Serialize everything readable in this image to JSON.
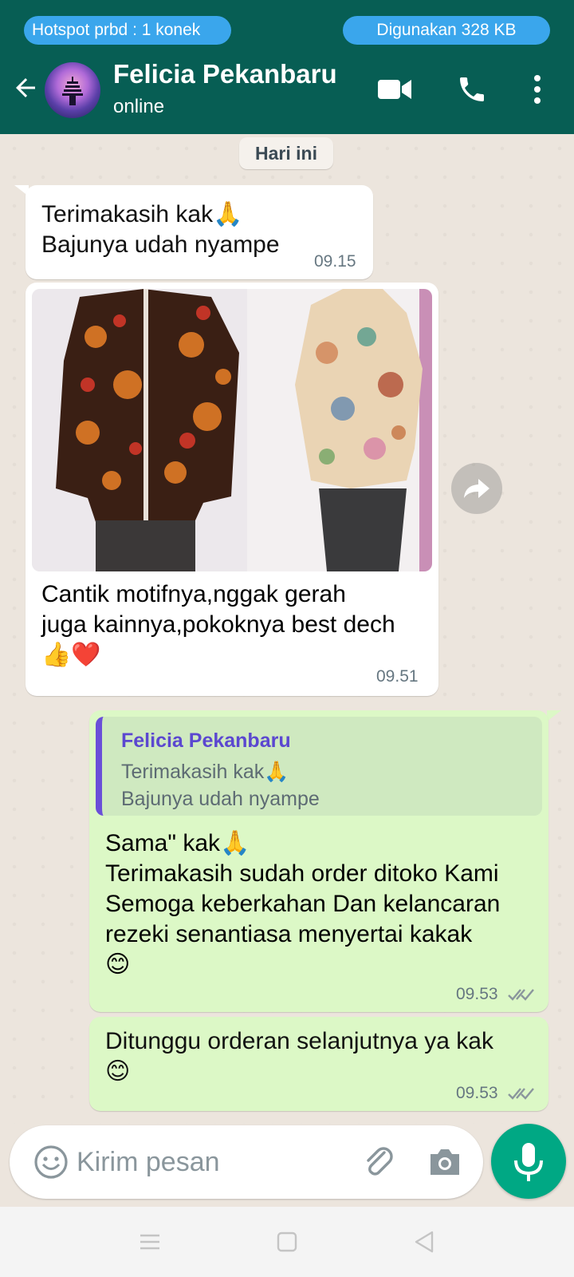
{
  "status_bar": {
    "hotspot_text": "Hotspot prbd : 1 konek",
    "data_used_text": "Digunakan 328 KB"
  },
  "header": {
    "contact_name": "Felicia Pekanbaru",
    "status": "online",
    "icons": [
      "back-arrow-icon",
      "video-call-icon",
      "voice-call-icon",
      "more-options-icon"
    ]
  },
  "chat": {
    "date_label": "Hari ini",
    "messages": [
      {
        "direction": "incoming",
        "text": "Terimakasih kak🙏\nBajunya udah nyampe",
        "time": "09.15"
      },
      {
        "direction": "incoming",
        "type": "image",
        "caption": "Cantik motifnya,nggak gerah\njuga kainnya,pokoknya best dech\n👍❤️",
        "time": "09.51"
      },
      {
        "direction": "outgoing",
        "quote_name": "Felicia Pekanbaru",
        "quote_text": "Terimakasih kak🙏\nBajunya udah nyampe",
        "text": "Sama\" kak🙏\nTerimakasih sudah order ditoko Kami\nSemoga keberkahan Dan kelancaran\nrezeki senantiasa menyertai kakak\n😊",
        "time": "09.53"
      },
      {
        "direction": "outgoing",
        "text": "Ditunggu orderan selanjutnya ya kak\n😊",
        "time": "09.53"
      }
    ]
  },
  "composer": {
    "placeholder": "Kirim pesan"
  },
  "colors": {
    "header": "#075e54",
    "outgoing_bubble": "#dcf8c6",
    "incoming_bubble": "#ffffff",
    "accent": "#00a884",
    "pill": "#3aa6ec"
  }
}
